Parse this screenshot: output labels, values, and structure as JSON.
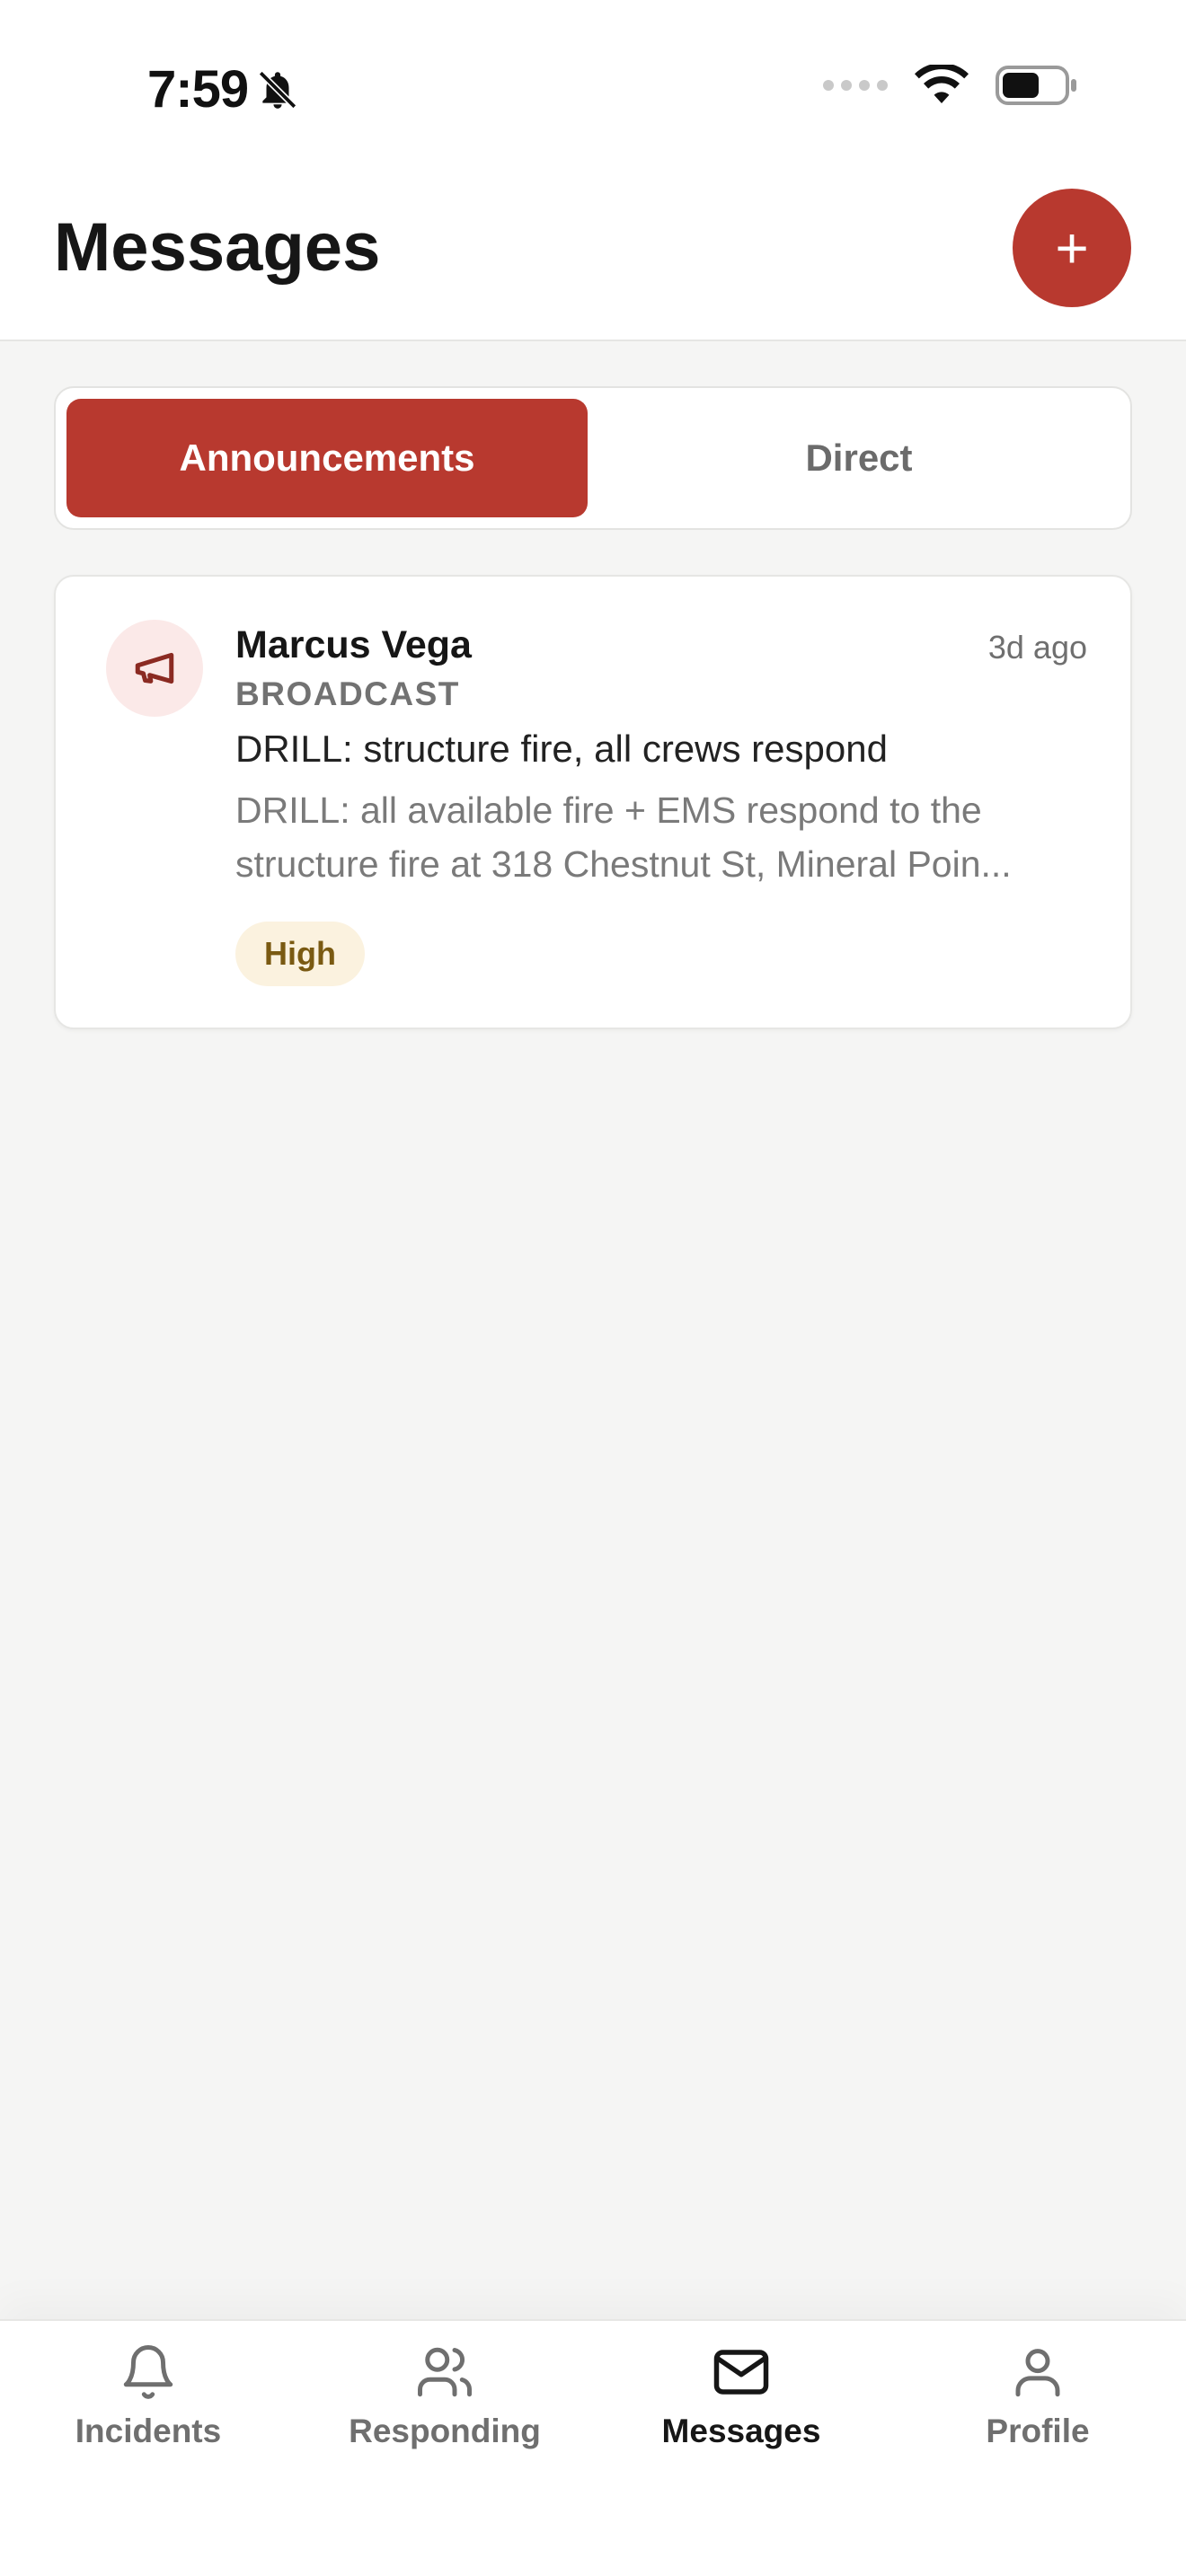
{
  "status_bar": {
    "time": "7:59",
    "icons": [
      "bell-slash-icon",
      "signal-icon",
      "wifi-icon",
      "battery-icon"
    ]
  },
  "header": {
    "title": "Messages",
    "compose_label": "+"
  },
  "tabs": [
    {
      "label": "Announcements",
      "active": true
    },
    {
      "label": "Direct",
      "active": false
    }
  ],
  "messages": [
    {
      "sender": "Marcus Vega",
      "time": "3d ago",
      "kind": "BROADCAST",
      "subject": "DRILL: structure fire, all crews respond",
      "preview": "DRILL: all available fire + EMS respond to the structure fire at 318 Chestnut St, Mineral Poin...",
      "priority": "High",
      "icon": "megaphone-icon"
    }
  ],
  "bottom_nav": [
    {
      "label": "Incidents",
      "icon": "bell-icon",
      "active": false
    },
    {
      "label": "Responding",
      "icon": "users-icon",
      "active": false
    },
    {
      "label": "Messages",
      "icon": "mail-icon",
      "active": true
    },
    {
      "label": "Profile",
      "icon": "user-icon",
      "active": false
    }
  ],
  "colors": {
    "accent": "#b8392f",
    "background": "#f5f5f4",
    "badge_high_bg": "#fbf2df",
    "badge_high_text": "#7a5a12"
  }
}
